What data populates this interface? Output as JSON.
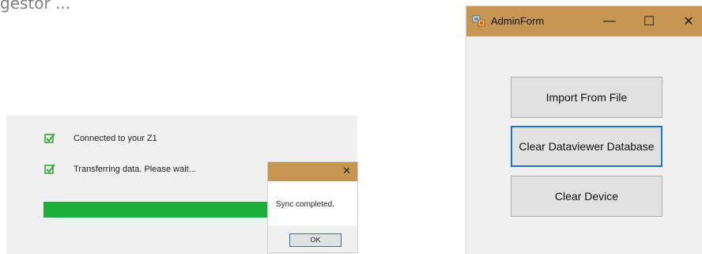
{
  "top_fragment_text": "gestor ...",
  "sync_panel": {
    "status_lines": [
      {
        "icon": "checkbox-checked-icon",
        "text": "Connected to your Z1"
      },
      {
        "icon": "checkbox-checked-icon",
        "text": "Transferring data. Please wait..."
      }
    ],
    "progress_percent": 100,
    "progress_color": "#1cad3b"
  },
  "sync_dialog": {
    "close_glyph": "✕",
    "message": "Sync completed.",
    "ok_label": "OK"
  },
  "admin_form": {
    "title": "AdminForm",
    "title_bar_color": "#c89653",
    "controls": {
      "minimize": "—",
      "maximize": "☐",
      "close": "✕"
    },
    "buttons": [
      {
        "label": "Import From File"
      },
      {
        "label": "Clear Dataviewer Database",
        "focused": true
      },
      {
        "label": "Clear Device"
      }
    ]
  }
}
